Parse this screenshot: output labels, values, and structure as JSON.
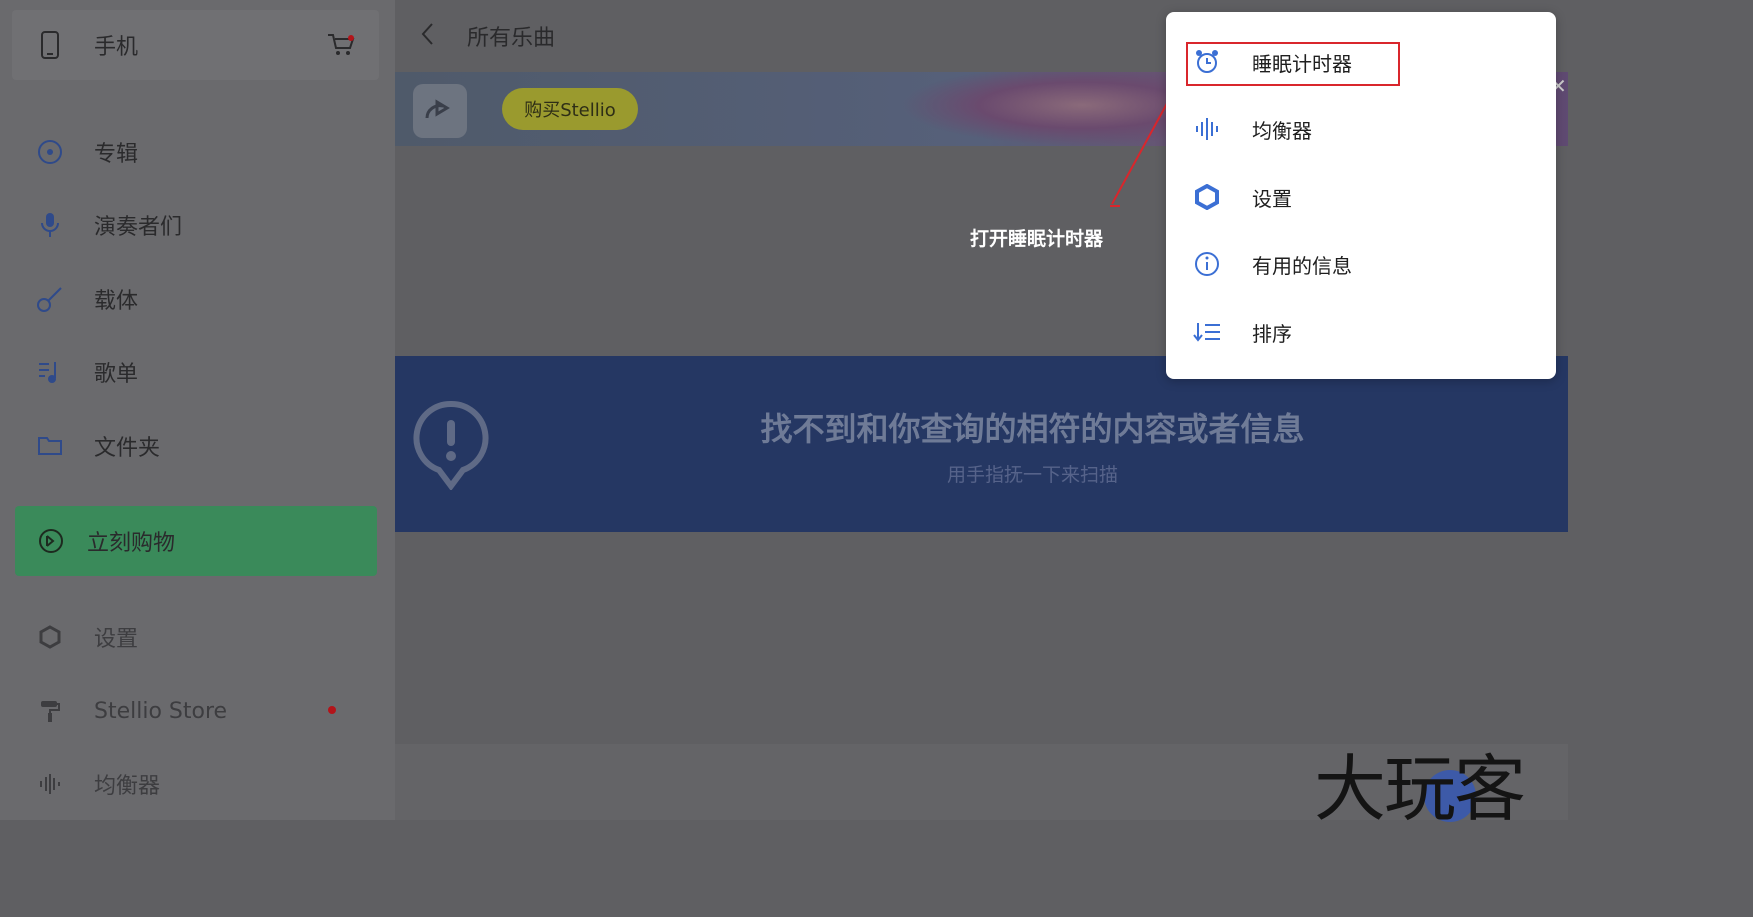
{
  "sidebar": {
    "device": {
      "label": "手机",
      "icon": "phone-icon",
      "cart_icon": "cart-icon"
    },
    "items": [
      {
        "label": "专辑",
        "icon": "disc-icon"
      },
      {
        "label": "演奏者们",
        "icon": "microphone-icon"
      },
      {
        "label": "载体",
        "icon": "guitar-icon"
      },
      {
        "label": "歌单",
        "icon": "playlist-icon"
      },
      {
        "label": "文件夹",
        "icon": "folder-icon"
      }
    ],
    "shop": {
      "label": "立刻购物",
      "icon": "shop-icon",
      "color": "#3a8a5a"
    },
    "bottom_items": [
      {
        "label": "设置",
        "icon": "gear-icon"
      },
      {
        "label": "Stellio Store",
        "icon": "paint-roller-icon",
        "badge_color": "#b3141a"
      },
      {
        "label": "均衡器",
        "icon": "equalizer-icon"
      }
    ]
  },
  "header": {
    "back_icon": "chevron-left-icon",
    "title": "所有乐曲"
  },
  "banner": {
    "button_label": "购买Stellio",
    "button_color": "#9a9a2e"
  },
  "notice": {
    "title": "找不到和你查询的相符的内容或者信息",
    "subtitle": "用手指抚一下来扫描",
    "icon": "alert-bubble-icon",
    "background": "#253763"
  },
  "menu": {
    "items": [
      {
        "label": "睡眠计时器",
        "icon": "alarm-clock-icon"
      },
      {
        "label": "均衡器",
        "icon": "equalizer-icon"
      },
      {
        "label": "设置",
        "icon": "gear-icon"
      },
      {
        "label": "有用的信息",
        "icon": "info-icon"
      },
      {
        "label": "排序",
        "icon": "sort-icon"
      }
    ],
    "accent": "#3b6fd4"
  },
  "annotation": {
    "text": "打开睡眠计时器",
    "color": "#d9262c"
  },
  "watermark": {
    "text": "大玩客"
  }
}
